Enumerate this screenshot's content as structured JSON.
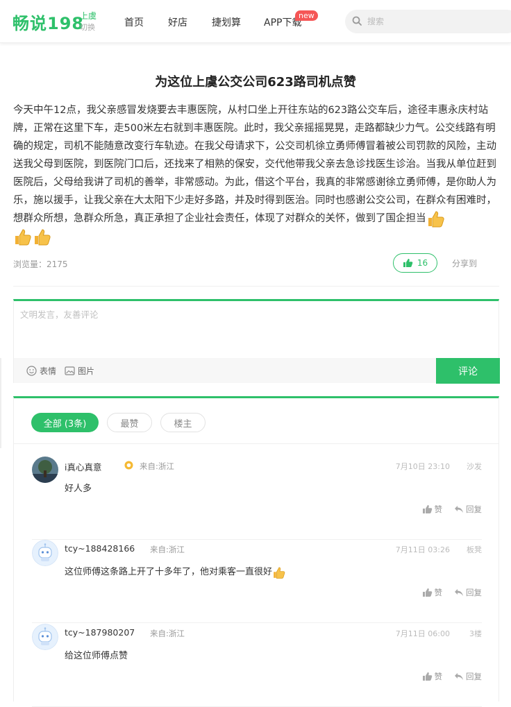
{
  "header": {
    "logo": "畅说198",
    "city": "上虞",
    "city_switch": "切换",
    "nav": [
      "首页",
      "好店",
      "捷划算",
      "APP下载"
    ],
    "new_badge": "new",
    "search_placeholder": "搜索"
  },
  "article": {
    "title": "为这位上虞公交公司623路司机点赞",
    "body": "今天中午12点，我父亲感冒发烧要去丰惠医院，从村口坐上开往东站的623路公交车后，途径丰惠永庆村站牌，正常在这里下车，走500米左右就到丰惠医院。此时，我父亲摇摇晃晃，走路都缺少力气。公交线路有明确的规定，司机不能随意改变行车轨迹。在我父母请求下，公交司机徐立勇师傅冒着被公司罚款的风险，主动送我父母到医院，到医院门口后，还找来了相熟的保安，交代他带我父亲去急诊找医生诊治。当我从单位赶到医院后，父母给我讲了司机的善举，非常感动。为此，借这个平台，我真的非常感谢徐立勇师傅，是你助人为乐，施以援手，让我父亲在大太阳下少走好多路，并及时得到医治。同时也感谢公交公司，在群众有困难时，想群众所想，急群众所急，真正承担了企业社会责任，体现了对群众的关怀，做到了国企担当",
    "views_label": "浏览量：2175",
    "likes": "16",
    "share": "分享到"
  },
  "comment_box": {
    "placeholder": "文明发言，友善评论",
    "emoji": "表情",
    "image": "图片",
    "submit": "评论"
  },
  "filters": [
    "全部 (3条)",
    "最赞",
    "楼主"
  ],
  "comments": [
    {
      "user": "i真心真意",
      "from": "来自:浙江",
      "time": "7月10日 23:10",
      "floor": "沙发",
      "text": "好人多",
      "like": "赞",
      "reply": "回复"
    },
    {
      "user": "tcy~188428166",
      "from": "来自:浙江",
      "time": "7月11日 03:26",
      "floor": "板凳",
      "text": "这位师傅这条路上开了十多年了，他对乘客一直很好",
      "like": "赞",
      "reply": "回复"
    },
    {
      "user": "tcy~187980207",
      "from": "来自:浙江",
      "time": "7月11日 06:00",
      "floor": "3楼",
      "text": "给这位师傅点赞",
      "like": "赞",
      "reply": "回复"
    }
  ],
  "colors": {
    "accent": "#2ec06a",
    "badge": "#f55656"
  }
}
